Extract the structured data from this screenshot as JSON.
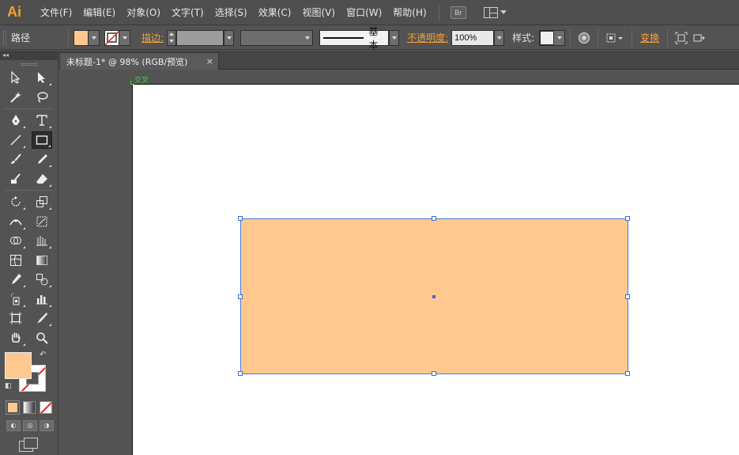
{
  "app": {
    "logo": "Ai"
  },
  "menu": {
    "items": [
      "文件(F)",
      "编辑(E)",
      "对象(O)",
      "文字(T)",
      "选择(S)",
      "效果(C)",
      "视图(V)",
      "窗口(W)",
      "帮助(H)"
    ],
    "bridge_label": "Br"
  },
  "control": {
    "selection_type": "路径",
    "fill_color": "#ffc88f",
    "stroke_label": "描边:",
    "stroke_profile": "基本",
    "opacity_label": "不透明度:",
    "opacity_value": "100%",
    "style_label": "样式:",
    "transform_label": "变换"
  },
  "document": {
    "tab_title": "未标题-1* @ 98% (RGB/预览)",
    "close": "×"
  },
  "canvas": {
    "smart_guide_label": "交叉",
    "shape_fill": "#ffc88f",
    "selection_color": "#4a7bd6"
  },
  "toolbox": {
    "collapse_label": "◂◂",
    "fill_color": "#ffc88f",
    "swap_glyph": "↶",
    "default_glyph": "◧",
    "draw_modes": [
      "◐",
      "◎",
      "◑"
    ]
  }
}
